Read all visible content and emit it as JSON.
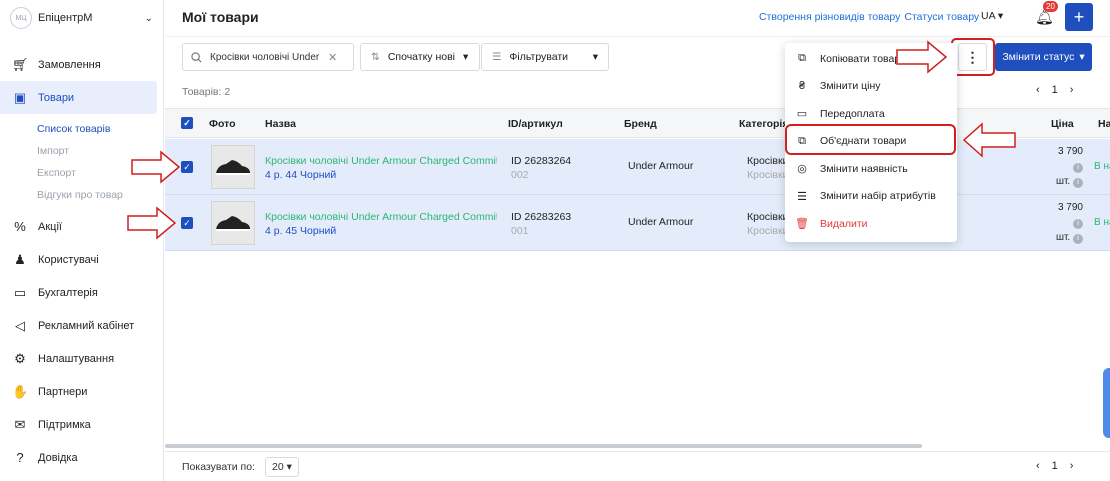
{
  "brand": {
    "logo": "МЦ",
    "name": "ЕпіцентрМ"
  },
  "nav": [
    {
      "label": "Замовлення",
      "icon": "cart-icon"
    },
    {
      "label": "Товари",
      "icon": "box-icon",
      "active": true
    },
    {
      "label": "Акції",
      "icon": "percent-bag-icon"
    },
    {
      "label": "Користувачі",
      "icon": "users-icon"
    },
    {
      "label": "Бухгалтерія",
      "icon": "wallet-icon"
    },
    {
      "label": "Рекламний кабінет",
      "icon": "megaphone-icon"
    },
    {
      "label": "Налаштування",
      "icon": "gear-icon"
    },
    {
      "label": "Партнери",
      "icon": "handshake-icon"
    },
    {
      "label": "Підтримка",
      "icon": "chat-icon"
    },
    {
      "label": "Довідка",
      "icon": "help-icon"
    }
  ],
  "subnav": [
    "Список товарів",
    "Імпорт",
    "Експорт",
    "Відгуки про товар"
  ],
  "header": {
    "title": "Мої товари",
    "link_variants": "Створення різновидів товару",
    "link_statuses": "Статуси товару",
    "lang": "UA",
    "notifications": "20"
  },
  "toolbar": {
    "search_value": "Кросівки чоловічі Under Armour",
    "sort_label": "Спочатку нові",
    "filter_label": "Фільтрувати",
    "status_button": "Змінити статус"
  },
  "count_label": "Товарів: 2",
  "pager": {
    "page": "1"
  },
  "table": {
    "headers": {
      "photo": "Фото",
      "name": "Назва",
      "id": "ID/артикул",
      "brand": "Бренд",
      "category": "Категорія",
      "price": "Ціна",
      "avail": "На"
    },
    "rows": [
      {
        "name_green": "Кросівки чоловічі Under Armour Charged Commit Tr",
        "name_blue": "4 р. 44 Чорний",
        "id": "ID 26283264",
        "article": "002",
        "brand": "Under Armour",
        "category": "Кросівки",
        "category_sub": "Кросівки",
        "price": "3 790",
        "unit": "шт.",
        "avail": "В на"
      },
      {
        "name_green": "Кросівки чоловічі Under Armour Charged Commit Tr",
        "name_blue": "4 р. 45 Чорний",
        "id": "ID 26283263",
        "article": "001",
        "brand": "Under Armour",
        "category": "Кросівки",
        "category_sub": "Кросівки",
        "price": "3 790",
        "unit": "шт.",
        "avail": "В на"
      }
    ]
  },
  "menu": [
    {
      "label": "Копіювати товар",
      "icon": "copy-icon"
    },
    {
      "label": "Змінити ціну",
      "icon": "hryvnia-icon"
    },
    {
      "label": "Передоплата",
      "icon": "card-icon"
    },
    {
      "label": "Об'єднати товари",
      "icon": "merge-icon"
    },
    {
      "label": "Змінити наявність",
      "icon": "check-circle-icon"
    },
    {
      "label": "Змінити набір атрибутів",
      "icon": "list-icon"
    },
    {
      "label": "Видалити",
      "icon": "trash-icon",
      "danger": true
    }
  ],
  "footer": {
    "per_page_label": "Показувати по:",
    "per_page_value": "20"
  }
}
